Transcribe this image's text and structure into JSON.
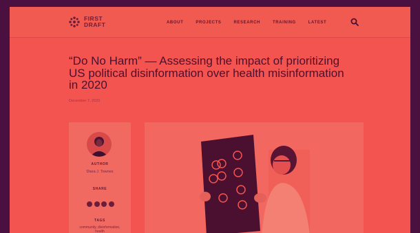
{
  "logo": {
    "line1": "FIRST",
    "line2": "DRAFT"
  },
  "nav": [
    "ABOUT",
    "PROJECTS",
    "RESEARCH",
    "TRAINING",
    "LATEST"
  ],
  "article": {
    "title": "“Do No Harm” — Assessing the impact of prioritizing US political disinformation over health misinformation in 2020",
    "date": "December 7, 2020"
  },
  "sidebar": {
    "author_label": "AUTHOR",
    "author_name": "Diara J. Townes",
    "share_label": "SHARE",
    "share_icons": [
      "facebook-icon",
      "twitter-icon",
      "linkedin-icon",
      "email-icon"
    ],
    "tags_label": "TAGS",
    "tags_text": "community, disinformation, health"
  },
  "colors": {
    "background": "#4a1040",
    "page": "#f4544f",
    "text_dark": "#4b1030"
  }
}
